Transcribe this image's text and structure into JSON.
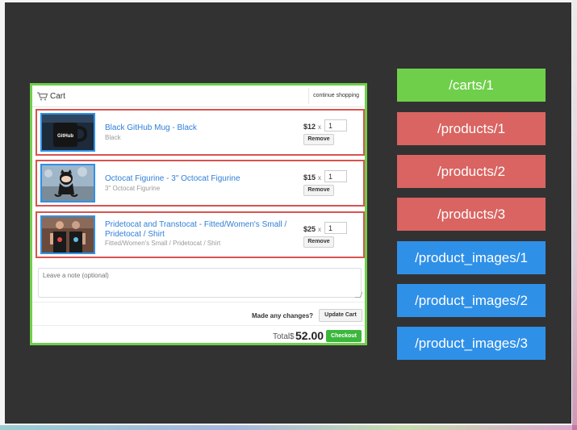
{
  "cart": {
    "title": "Cart",
    "continue_label": "continue shopping",
    "items": [
      {
        "name": "Black GitHub Mug - Black",
        "variant": "Black",
        "price": "$12",
        "times": "x",
        "quantity": "1",
        "remove_label": "Remove",
        "thumb_icon": "github-mug-image",
        "thumb_text": "GitHub"
      },
      {
        "name": "Octocat Figurine - 3\" Octocat Figurine",
        "variant": "3\" Octocat Figurine",
        "price": "$15",
        "times": "x",
        "quantity": "1",
        "remove_label": "Remove",
        "thumb_icon": "octocat-figurine-image"
      },
      {
        "name": "Pridetocat and Transtocat - Fitted/Women's Small / Pridetocat / Shirt",
        "variant": "Fitted/Women's Small / Pridetocat / Shirt",
        "price": "$25",
        "times": "x",
        "quantity": "1",
        "remove_label": "Remove",
        "thumb_icon": "pridetocat-shirt-image"
      }
    ],
    "note_placeholder": "Leave a note (optional)",
    "changes_label": "Made any changes?",
    "update_label": "Update Cart",
    "total_label": "Total",
    "total_currency": "$",
    "total_value": "52.00",
    "checkout_label": "Checkout"
  },
  "routes": [
    {
      "label": "/carts/1",
      "color": "#6fcf4a"
    },
    {
      "label": "/products/1",
      "color": "#d96461"
    },
    {
      "label": "/products/2",
      "color": "#d96461"
    },
    {
      "label": "/products/3",
      "color": "#d96461"
    },
    {
      "label": "/product_images/1",
      "color": "#2f90e8"
    },
    {
      "label": "/product_images/2",
      "color": "#2f90e8"
    },
    {
      "label": "/product_images/3",
      "color": "#2f90e8"
    }
  ],
  "colors": {
    "background": "#323232",
    "cart_highlight": "#6fcf4a",
    "product_highlight": "#d9534f",
    "image_highlight": "#2f90e8",
    "link": "#2f7fd8",
    "checkout": "#3cb73c"
  }
}
